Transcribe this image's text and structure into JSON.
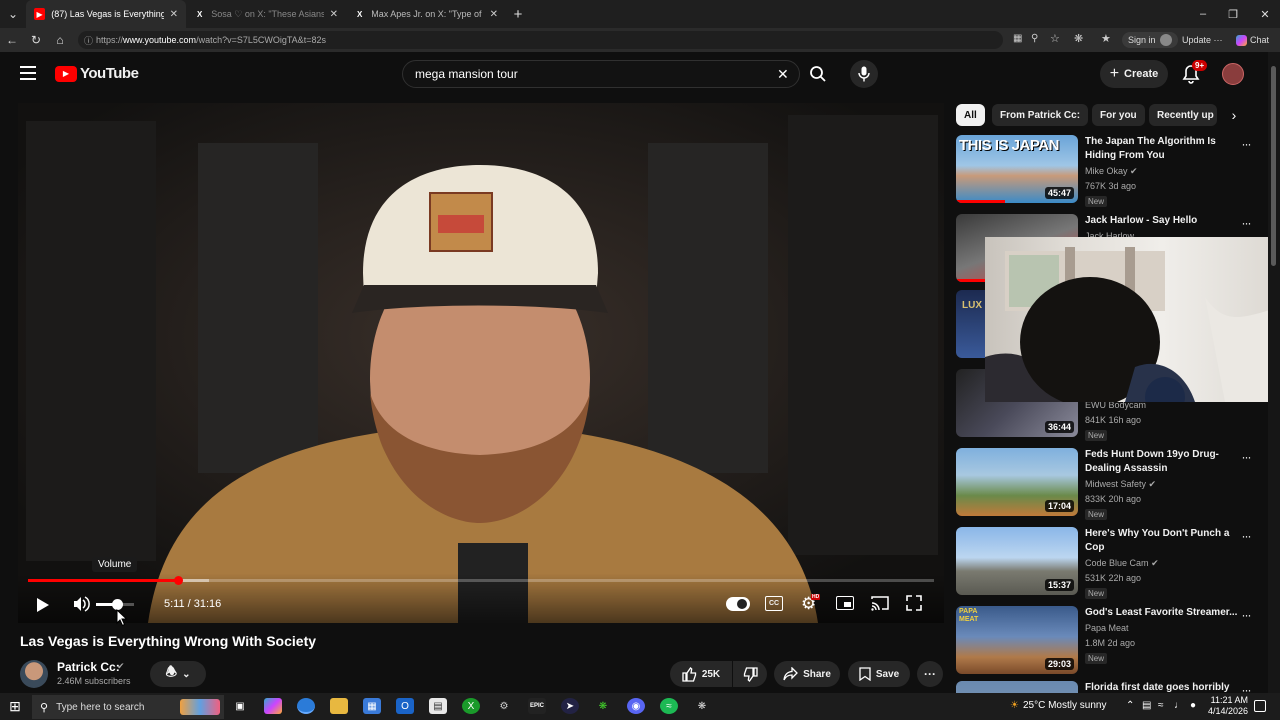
{
  "browser": {
    "tabs": [
      {
        "label": "(87) Las Vegas is Everything Wrong",
        "active": true,
        "favicon": "youtube-icon"
      },
      {
        "label": "Sosa ♡ on X: \"These Asians got a",
        "active": false,
        "favicon": "x-icon"
      },
      {
        "label": "Max Apes Jr. on X: \"Type of timing",
        "active": false,
        "favicon": "x-icon"
      }
    ],
    "url_prefix": "https://",
    "url_host": "www.youtube.com",
    "url_path": "/watch?v=S7L5CWOigTA&t=82s",
    "sign_in": "Sign in",
    "update": "Update",
    "chat": "Chat"
  },
  "yt": {
    "logo": "YouTube",
    "search_value": "mega mansion tour",
    "create": "Create",
    "notif_count": "9+"
  },
  "player": {
    "time": "5:11 / 31:16",
    "progress_fraction": 0.166,
    "volume_fraction": 0.55,
    "tooltip": "Volume"
  },
  "video": {
    "title": "Las Vegas is Everything Wrong With Society",
    "channel": "Patrick Cc:",
    "subscribers": "2.46M subscribers",
    "likes": "25K",
    "share": "Share",
    "save": "Save"
  },
  "chips": [
    "All",
    "From Patrick Cc:",
    "For you",
    "Recently up"
  ],
  "recommendations": [
    {
      "title": "The Japan The Algorithm Is Hiding From You",
      "channel": "Mike Okay",
      "meta": "767K  3d ago",
      "badge": "New",
      "duration": "45:47",
      "thumb_text": "THIS IS JAPAN"
    },
    {
      "title": "Jack Harlow - Say Hello",
      "channel": "Jack Harlow",
      "meta": "",
      "badge": "",
      "duration": "",
      "thumb_text": ""
    },
    {
      "title": "",
      "channel": "",
      "meta": "",
      "badge": "",
      "duration": "",
      "thumb_text": "LUX"
    },
    {
      "title": "",
      "channel": "EWU Bodycam",
      "meta": "841K  16h ago",
      "badge": "New",
      "duration": "36:44",
      "thumb_text": ""
    },
    {
      "title": "Feds Hunt Down 19yo Drug-Dealing Assassin",
      "channel": "Midwest Safety",
      "meta": "833K  20h ago",
      "badge": "New",
      "duration": "17:04",
      "thumb_text": ""
    },
    {
      "title": "Here's Why You Don't Punch a Cop",
      "channel": "Code Blue Cam",
      "meta": "531K  22h ago",
      "badge": "New",
      "duration": "15:37",
      "thumb_text": ""
    },
    {
      "title": "God's Least Favorite Streamer...",
      "channel": "Papa Meat",
      "meta": "1.8M  2d ago",
      "badge": "New",
      "duration": "29:03",
      "thumb_text": "PAPA MEAT"
    },
    {
      "title": "Florida first date goes horribly",
      "channel": "",
      "meta": "",
      "badge": "",
      "duration": "",
      "thumb_text": ""
    }
  ],
  "taskbar": {
    "search_placeholder": "Type here to search",
    "weather": "25°C  Mostly sunny",
    "time": "11:21 AM",
    "date": "4/14/2026"
  }
}
